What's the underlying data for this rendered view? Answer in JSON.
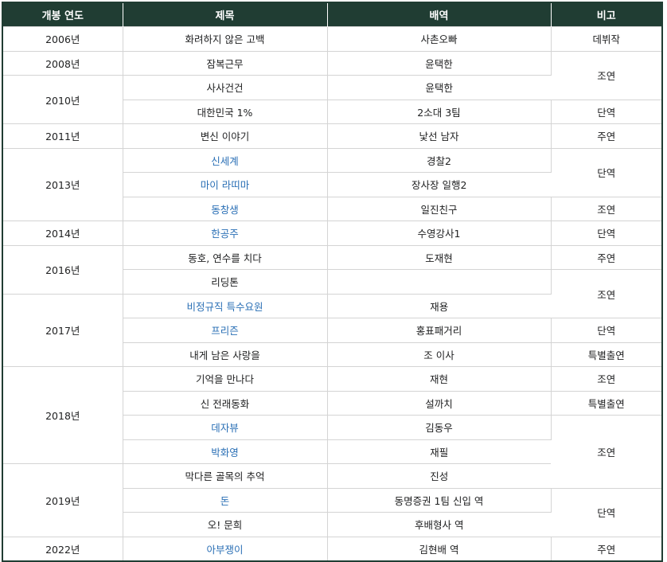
{
  "table": {
    "headers": [
      "개봉 연도",
      "제목",
      "배역",
      "비고"
    ],
    "rows": [
      {
        "year": "2006년",
        "year_rowspan": 1,
        "title": "화려하지 않은 고백",
        "title_link": false,
        "role": "사촌오빠",
        "note": "데뷔작",
        "note_rowspan": 1
      },
      {
        "year": "2008년",
        "year_rowspan": 1,
        "title": "잠복근무",
        "title_link": false,
        "role": "윤택한",
        "note": "조연",
        "note_rowspan": 2
      },
      {
        "year": "2010년",
        "year_rowspan": 2,
        "title": "사사건건",
        "title_link": false,
        "role": "윤택한"
      },
      {
        "title": "대한민국 1%",
        "title_link": false,
        "role": "2소대 3팀",
        "note": "단역",
        "note_rowspan": 1
      },
      {
        "year": "2011년",
        "year_rowspan": 1,
        "title": "변신 이야기",
        "title_link": false,
        "role": "낯선 남자",
        "note": "주연",
        "note_rowspan": 1
      },
      {
        "year": "2013년",
        "year_rowspan": 3,
        "title": "신세계",
        "title_link": true,
        "role": "경찰2",
        "note": "단역",
        "note_rowspan": 2
      },
      {
        "title": "마이 라띠마",
        "title_link": true,
        "role": "장사장 일행2"
      },
      {
        "title": "동창생",
        "title_link": true,
        "role": "일진친구",
        "note": "조연",
        "note_rowspan": 1
      },
      {
        "year": "2014년",
        "year_rowspan": 1,
        "title": "한공주",
        "title_link": true,
        "role": "수영강사1",
        "note": "단역",
        "note_rowspan": 1
      },
      {
        "year": "2016년",
        "year_rowspan": 2,
        "title": "동호, 연수를 치다",
        "title_link": false,
        "role": "도재현",
        "note": "주연",
        "note_rowspan": 1
      },
      {
        "title": "리딩톤",
        "title_link": false,
        "role": "",
        "note": "조연",
        "note_rowspan": 2
      },
      {
        "year": "2017년",
        "year_rowspan": 3,
        "title": "비정규직 특수요원",
        "title_link": true,
        "role": "재용"
      },
      {
        "title": "프리즌",
        "title_link": true,
        "role": "홍표패거리",
        "note": "단역",
        "note_rowspan": 1
      },
      {
        "title": "내게 남은 사랑을",
        "title_link": false,
        "role": "조 이사",
        "note": "특별출연",
        "note_rowspan": 1
      },
      {
        "year": "2018년",
        "year_rowspan": 4,
        "title": "기억을 만나다",
        "title_link": false,
        "role": "재현",
        "note": "조연",
        "note_rowspan": 1
      },
      {
        "title": "신 전래동화",
        "title_link": false,
        "role": "설까치",
        "note": "특별출연",
        "note_rowspan": 1
      },
      {
        "title": "데자뷰",
        "title_link": true,
        "role": "김동우",
        "note": "조연",
        "note_rowspan": 3
      },
      {
        "title": "박화영",
        "title_link": true,
        "role": "재필"
      },
      {
        "year": "2019년",
        "year_rowspan": 3,
        "title": "막다른 골목의 추억",
        "title_link": false,
        "role": "진성"
      },
      {
        "title": "돈",
        "title_link": true,
        "role": "동명증권 1팀 신입 역",
        "note": "단역",
        "note_rowspan": 2
      },
      {
        "title": "오! 문희",
        "title_link": false,
        "role": "후배형사 역"
      },
      {
        "year": "2022년",
        "year_rowspan": 1,
        "title": "아부쟁이",
        "title_link": true,
        "role": "김현배 역",
        "note": "주연",
        "note_rowspan": 1
      }
    ]
  },
  "colors": {
    "header_bg": "#203d33",
    "link": "#2a6fb5",
    "border": "#d4d4d4"
  }
}
